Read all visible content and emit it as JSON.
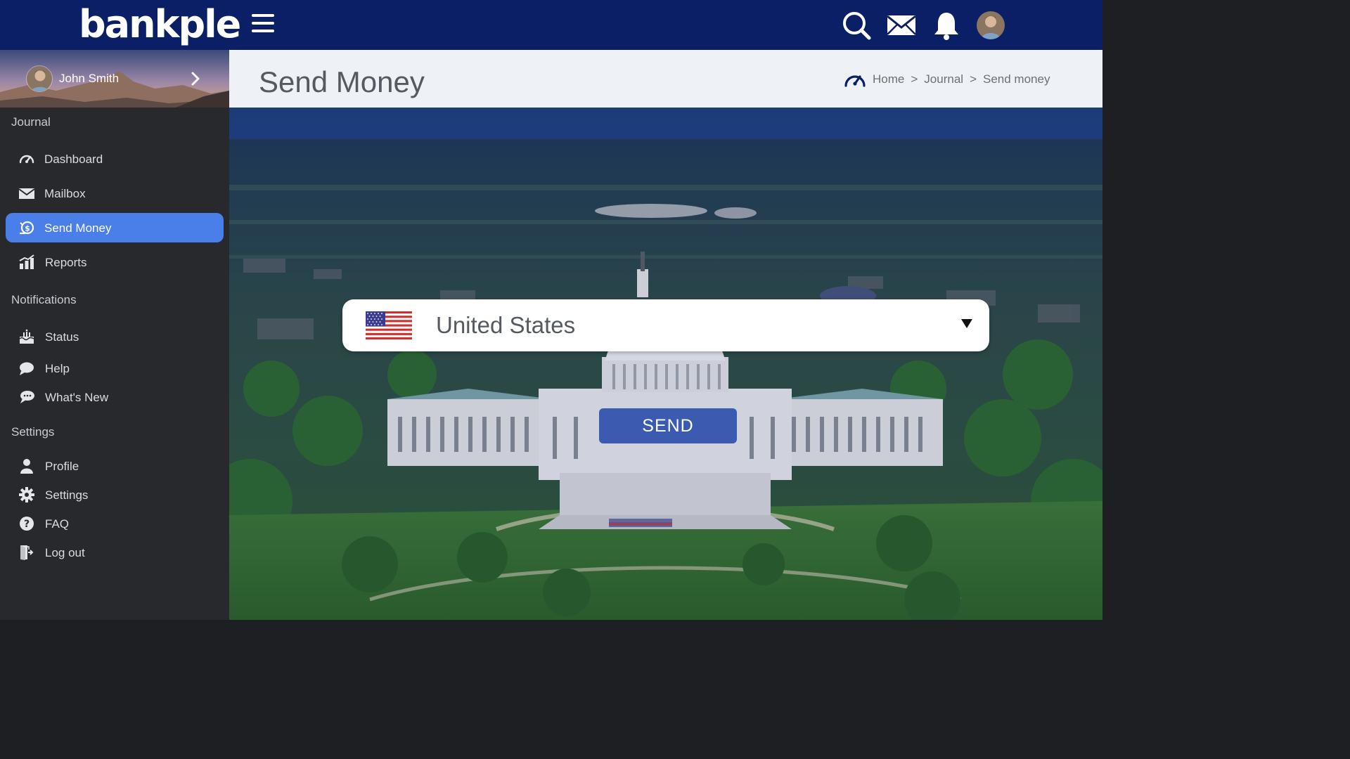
{
  "brand": {
    "logo_text": "bankple"
  },
  "topbar": {
    "icons": [
      "search-icon",
      "mail-icon",
      "bell-icon",
      "avatar"
    ],
    "color": "#0b1f66"
  },
  "user": {
    "name": "John Smith"
  },
  "sidebar": {
    "sections": [
      {
        "title": "Journal",
        "items": [
          {
            "label": "Dashboard",
            "icon": "speedometer-icon"
          },
          {
            "label": "Mailbox",
            "icon": "mail-icon"
          },
          {
            "label": "Send Money",
            "icon": "money-icon",
            "active": true
          },
          {
            "label": "Reports",
            "icon": "chart-icon"
          }
        ]
      },
      {
        "title": "Notifications",
        "items": [
          {
            "label": "Status",
            "icon": "cake-icon"
          },
          {
            "label": "Help",
            "icon": "chat-icon"
          },
          {
            "label": "What's New",
            "icon": "bubbles-icon"
          }
        ]
      },
      {
        "title": "Settings",
        "items": [
          {
            "label": "Profile",
            "icon": "person-icon"
          },
          {
            "label": "Settings",
            "icon": "gear-icon"
          },
          {
            "label": "FAQ",
            "icon": "question-icon"
          },
          {
            "label": "Log out",
            "icon": "logout-icon"
          }
        ]
      }
    ],
    "active_color": "#4a7ee8"
  },
  "header": {
    "title": "Send Money",
    "breadcrumb": [
      "Home",
      "Journal",
      "Send money"
    ],
    "separator": ">"
  },
  "form": {
    "country": {
      "selected": "United States",
      "flag": "us-flag-icon"
    },
    "send_label": "SEND"
  }
}
